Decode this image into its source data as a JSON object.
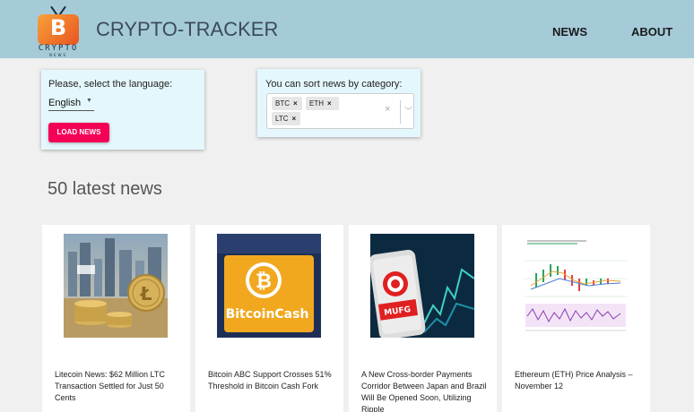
{
  "header": {
    "logo": {
      "mark": "B",
      "text": "CRYPTO",
      "subtext": "NEWS"
    },
    "title": "CRYPTO-TRACKER",
    "nav": [
      {
        "label": "NEWS"
      },
      {
        "label": "ABOUT"
      }
    ]
  },
  "language_panel": {
    "label": "Please, select the language:",
    "selected_language": "English",
    "load_button_label": "LOAD NEWS"
  },
  "sort_panel": {
    "label": "You can sort news by category:",
    "selected_categories": [
      "BTC",
      "ETH",
      "LTC"
    ],
    "clear_icon": "×",
    "dropdown_icon": "chevron-down-icon"
  },
  "news_section": {
    "heading": "50 latest news",
    "cards": [
      {
        "title": "Litecoin News: $62 Million LTC Transaction Settled for Just 50 Cents",
        "image": "litecoin-coins-city"
      },
      {
        "title": "Bitcoin ABC Support Crosses 51% Threshold in Bitcoin Cash Fork",
        "image": "bitcoin-cash-logo",
        "image_text": "BitcoinCash"
      },
      {
        "title": "A New Cross-border Payments Corridor Between Japan and Brazil Will Be Opened Soon, Utilizing Ripple",
        "image": "mufg-phone",
        "image_text": "MUFG"
      },
      {
        "title": "Ethereum (ETH) Price Analysis – November 12",
        "image": "eth-price-chart"
      }
    ]
  },
  "colors": {
    "header_bg": "#a5cbd9",
    "panel_bg": "#e4f7fd",
    "accent": "#f50057",
    "page_bg": "#f0f0f0"
  }
}
